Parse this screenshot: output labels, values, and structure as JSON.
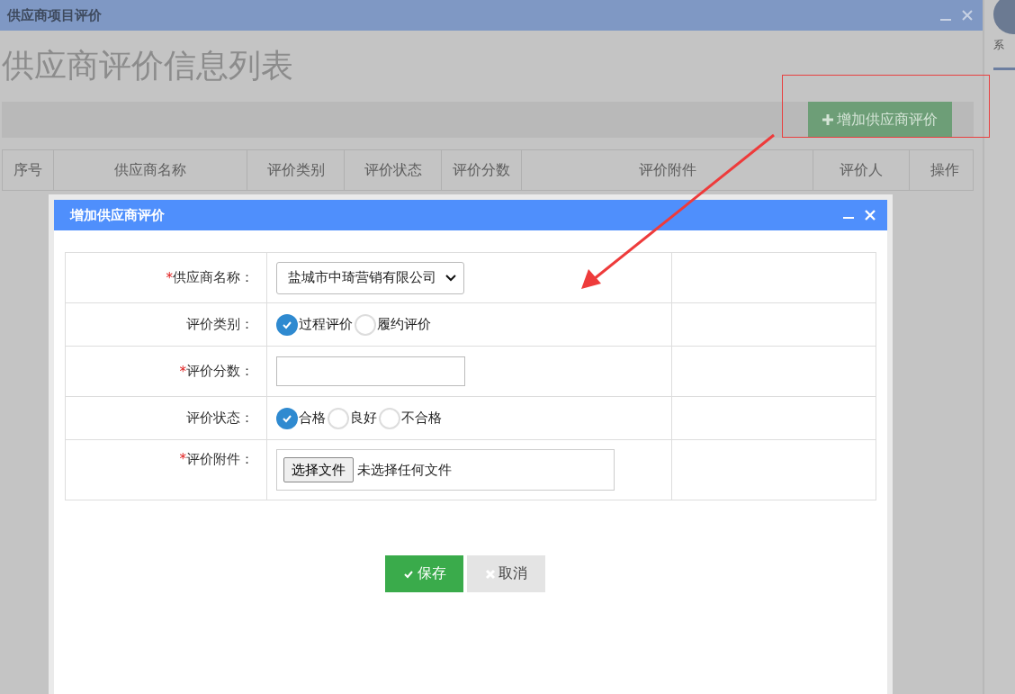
{
  "window": {
    "title": "供应商项目评价",
    "heading": "供应商评价信息列表",
    "add_button": "增加供应商评价",
    "columns": [
      "序号",
      "供应商名称",
      "评价类别",
      "评价状态",
      "评价分数",
      "评价附件",
      "评价人",
      "操作"
    ]
  },
  "side_panel": {
    "label": "系"
  },
  "dialog": {
    "title": "增加供应商评价",
    "fields": [
      {
        "kind": "select",
        "marker": "*",
        "label": "供应商名称：",
        "value": "盐城市中琦营销有限公司"
      },
      {
        "kind": "radio",
        "label": "评价类别：",
        "options": [
          {
            "label": "过程评价",
            "selected": true
          },
          {
            "label": "履约评价",
            "selected": false
          }
        ]
      },
      {
        "kind": "text",
        "marker": "*",
        "label": "评价分数："
      },
      {
        "kind": "radio",
        "label": "评价状态：",
        "options": [
          {
            "label": "合格",
            "selected": true
          },
          {
            "label": "良好",
            "selected": false
          },
          {
            "label": "不合格",
            "selected": false
          }
        ]
      },
      {
        "kind": "file",
        "marker": "*",
        "label": "评价附件：",
        "button": "选择文件",
        "status": "未选择任何文件"
      }
    ],
    "buttons": [
      {
        "kind": "save",
        "label": "保存"
      },
      {
        "kind": "cancel",
        "label": "取消"
      }
    ]
  }
}
